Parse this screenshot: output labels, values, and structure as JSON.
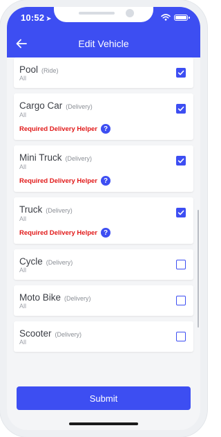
{
  "status": {
    "time": "10:52"
  },
  "header": {
    "title": "Edit Vehicle"
  },
  "vehicles": [
    {
      "name": "Pool",
      "type": "(Ride)",
      "sub": "All",
      "checked": true,
      "helper": ""
    },
    {
      "name": "Cargo Car",
      "type": "(Delivery)",
      "sub": "All",
      "checked": true,
      "helper": "Required Delivery Helper"
    },
    {
      "name": "Mini Truck",
      "type": "(Delivery)",
      "sub": "All",
      "checked": true,
      "helper": "Required Delivery Helper"
    },
    {
      "name": "Truck",
      "type": "(Delivery)",
      "sub": "All",
      "checked": true,
      "helper": "Required Delivery Helper"
    },
    {
      "name": "Cycle",
      "type": "(Delivery)",
      "sub": "All",
      "checked": false,
      "helper": ""
    },
    {
      "name": "Moto Bike",
      "type": "(Delivery)",
      "sub": "All",
      "checked": false,
      "helper": ""
    },
    {
      "name": "Scooter",
      "type": "(Delivery)",
      "sub": "All",
      "checked": false,
      "helper": ""
    }
  ],
  "submit_label": "Submit",
  "colors": {
    "accent": "#3d4ef2",
    "warning": "#e11818",
    "background": "#f4f5f7"
  },
  "icons": {
    "back": "arrow-left-icon",
    "help": "question-circle-icon",
    "check": "check-icon"
  }
}
